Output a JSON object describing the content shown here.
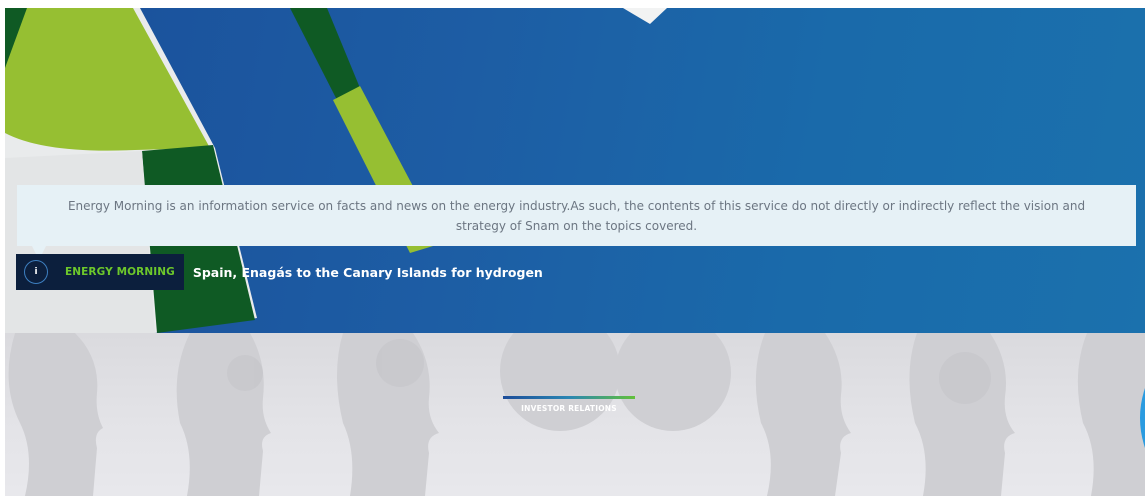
{
  "disclaimer": {
    "text": "Energy Morning is an information service on facts and news on the energy industry.As such, the contents of this service do not directly or indirectly reflect the vision and strategy of Snam on the topics covered."
  },
  "news_ticker": {
    "icon": "info-icon",
    "icon_glyph": "i",
    "category": "ENERGY MORNING",
    "headline": "Spain, Enagás to the Canary Islands for hydrogen"
  },
  "section": {
    "label": "INVESTOR RELATIONS"
  },
  "colors": {
    "hero_blue": "#1d5da4",
    "brand_green": "#6dc82b",
    "dark_green": "#0f5a24",
    "light_green": "#96bf32",
    "ticker_bg": "#0c1f3d",
    "disclaimer_bg": "#e6f1f6"
  }
}
